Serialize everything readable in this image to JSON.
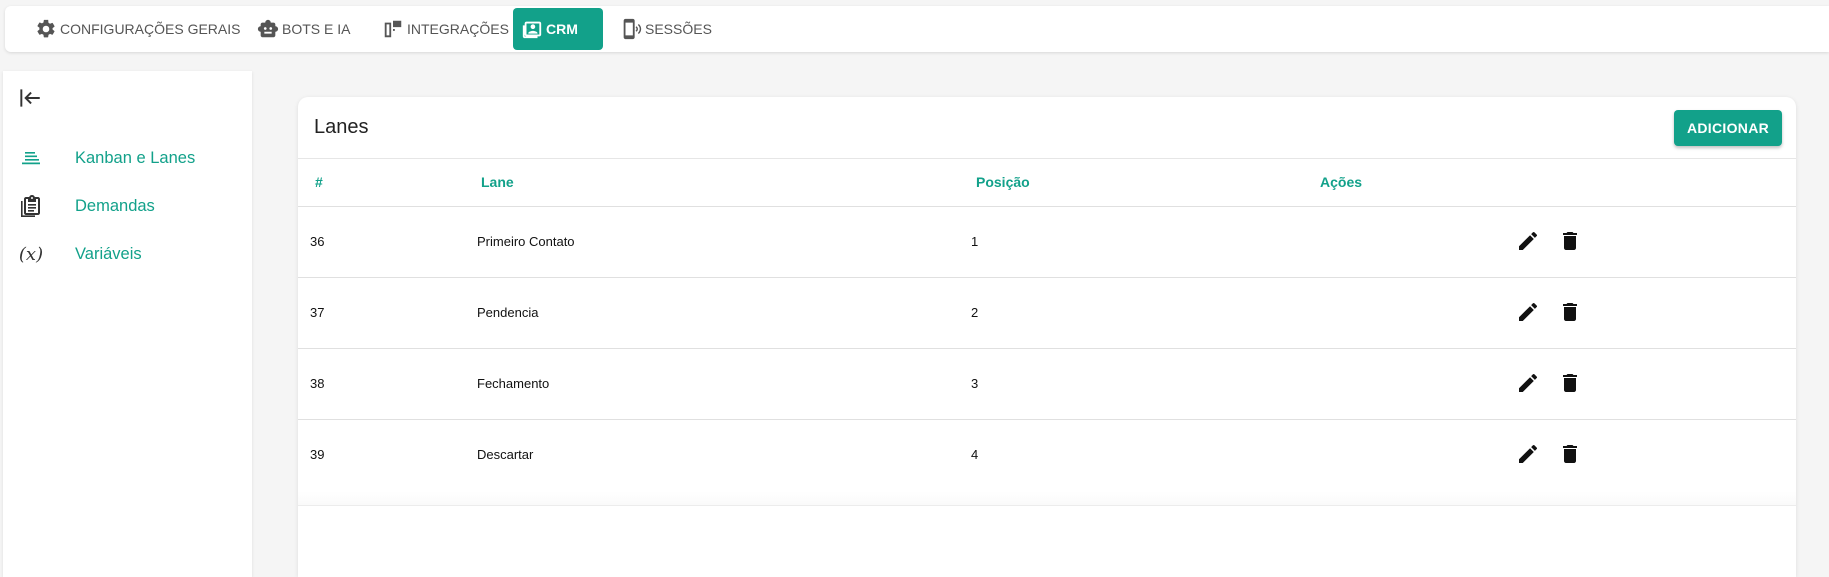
{
  "tabs": [
    {
      "label": "CONFIGURAÇÕES GERAIS",
      "icon": "gear-icon"
    },
    {
      "label": "BOTS E IA",
      "icon": "robot-icon"
    },
    {
      "label": "INTEGRAÇÕES",
      "icon": "devices-icon"
    },
    {
      "label": "CRM",
      "icon": "contact-card-icon"
    },
    {
      "label": "SESSÕES",
      "icon": "phone-session-icon"
    }
  ],
  "sidebar": {
    "items": [
      {
        "label": "Kanban e Lanes",
        "icon": "kanban-icon"
      },
      {
        "label": "Demandas",
        "icon": "clipboard-icon"
      },
      {
        "label": "Variáveis",
        "icon": "variable-icon",
        "icon_text": "(x)"
      }
    ]
  },
  "card": {
    "title": "Lanes",
    "add_label": "ADICIONAR"
  },
  "table": {
    "headers": [
      "#",
      "Lane",
      "Posição",
      "Ações"
    ],
    "rows": [
      {
        "id": "36",
        "lane": "Primeiro Contato",
        "position": "1"
      },
      {
        "id": "37",
        "lane": "Pendencia",
        "position": "2"
      },
      {
        "id": "38",
        "lane": "Fechamento",
        "position": "3"
      },
      {
        "id": "39",
        "lane": "Descartar",
        "position": "4"
      }
    ]
  },
  "colors": {
    "accent": "#12a18a",
    "background": "#f5f5f5"
  }
}
